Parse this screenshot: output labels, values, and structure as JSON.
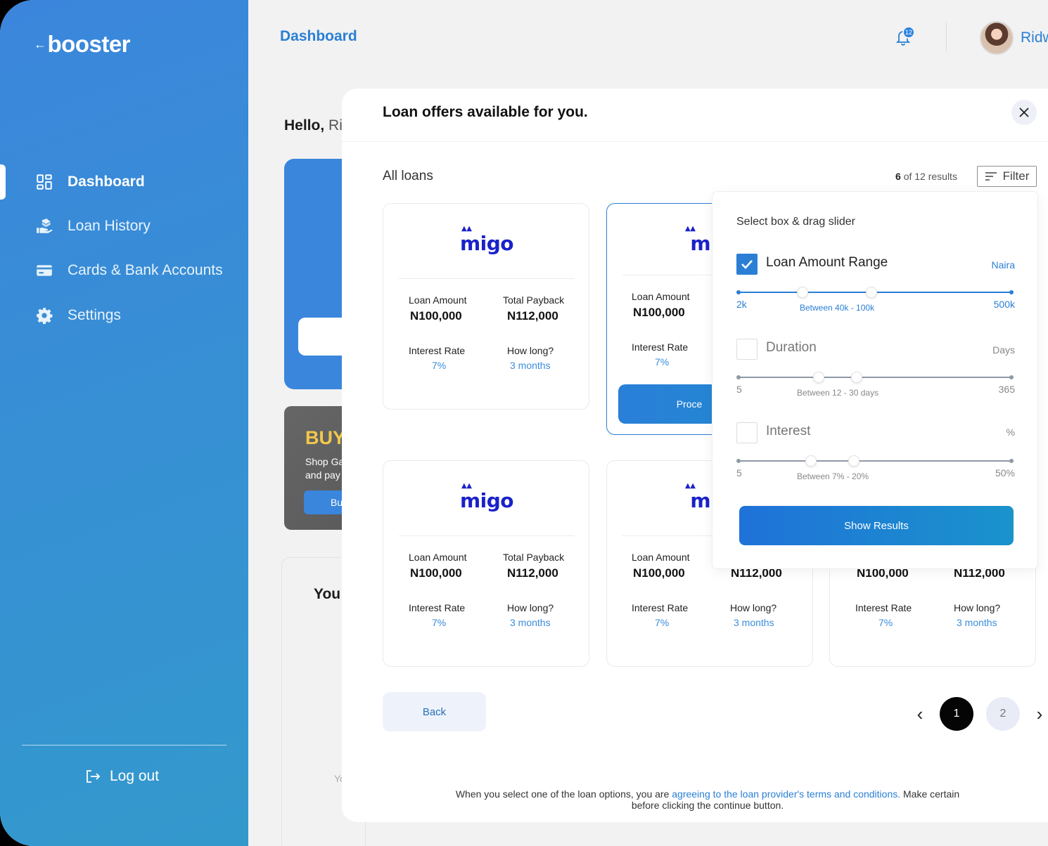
{
  "brand": {
    "name": "booster"
  },
  "sidebar": {
    "items": [
      {
        "label": "Dashboard",
        "icon": "grid-icon",
        "active": true
      },
      {
        "label": "Loan History",
        "icon": "money-hand-icon",
        "active": false
      },
      {
        "label": "Cards & Bank Accounts",
        "icon": "card-icon",
        "active": false
      },
      {
        "label": "Settings",
        "icon": "gear-icon",
        "active": false
      }
    ],
    "logout_label": "Log out"
  },
  "header": {
    "title": "Dashboard",
    "notification_count": "12",
    "user_name": "Ridw"
  },
  "background": {
    "hello_bold": "Hello,",
    "hello_name": "Ri",
    "promo_title": "BUY",
    "promo_text_1": "Shop Ga",
    "promo_text_2": "and pay",
    "promo_button": "Bu",
    "panel_title": "You",
    "panel_text": "Yo"
  },
  "modal": {
    "title": "Loan offers available for you.",
    "section_label": "All loans",
    "results_count": "6",
    "results_suffix": "of 12 results",
    "filter_label": "Filter",
    "back_label": "Back",
    "pages": [
      "1",
      "2"
    ],
    "current_page": "1",
    "footer_text_1": "When you select one of the loan options, you are",
    "footer_link": "agreeing to the loan provider's terms and conditions.",
    "footer_text_2": "Make certain before clicking the continue button."
  },
  "loan_cards": [
    {
      "provider": "migo",
      "amount_label": "Loan Amount",
      "amount": "N100,000",
      "payback_label": "Total Payback",
      "payback": "N112,000",
      "rate_label": "Interest Rate",
      "rate": "7%",
      "duration_label": "How long?",
      "duration": "3 months"
    },
    {
      "provider": "mig",
      "amount_label": "Loan Amount",
      "amount": "N100,000",
      "rate_label": "Interest Rate",
      "rate": "7%",
      "proceed_label": "Proce"
    },
    {
      "provider": "migo",
      "amount_label": "Loan Amount",
      "amount": "N100,000",
      "payback_label": "Total Payback",
      "payback": "N112,000",
      "rate_label": "Interest Rate",
      "rate": "7%",
      "duration_label": "How long?",
      "duration": "3 months"
    },
    {
      "provider": "mig",
      "amount_label": "Loan Amount",
      "amount": "N100,000",
      "payback": "N112,000",
      "rate_label": "Interest Rate",
      "rate": "7%",
      "duration_label": "How long?",
      "duration": "3 months"
    },
    {
      "amount": "N100,000",
      "payback": "N112,000",
      "rate_label": "Interest Rate",
      "rate": "7%",
      "duration_label": "How long?",
      "duration": "3 months"
    }
  ],
  "filter": {
    "title": "Select box & drag slider",
    "sections": [
      {
        "label": "Loan Amount Range",
        "unit": "Naira",
        "checked": true,
        "min": "2k",
        "max": "500k",
        "range_label": "Between 40k - 100k",
        "range_from": 0.24,
        "range_to": 0.49
      },
      {
        "label": "Duration",
        "unit": "Days",
        "checked": false,
        "min": "5",
        "max": "365",
        "range_label": "Between 12 - 30 days",
        "range_from": 0.29,
        "range_to": 0.43
      },
      {
        "label": "Interest",
        "unit": "%",
        "checked": false,
        "min": "5",
        "max": "50%",
        "range_label": "Between 7% - 20%",
        "range_from": 0.27,
        "range_to": 0.43
      }
    ],
    "show_results_label": "Show Results"
  },
  "colors": {
    "accent": "#2a7fd4",
    "sidebar_start": "#3b86dc",
    "sidebar_end": "#3399cc",
    "migo": "#1a22c9",
    "promo_yellow": "#f2c84b"
  }
}
